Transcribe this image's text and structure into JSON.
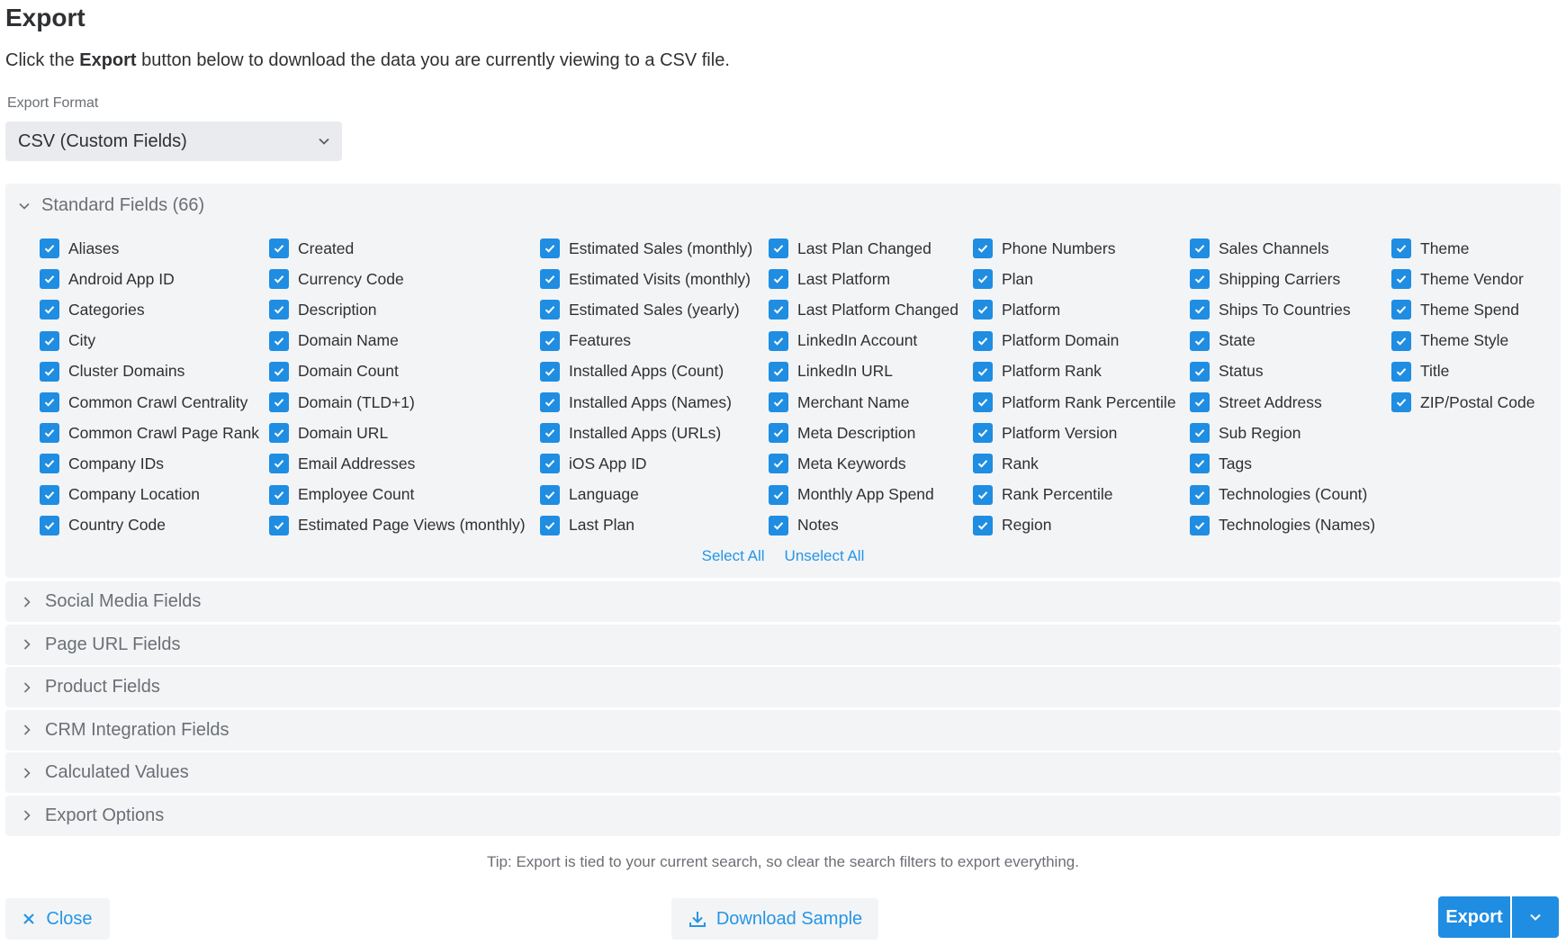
{
  "page": {
    "title": "Export",
    "intro_prefix": "Click the ",
    "intro_bold": "Export",
    "intro_suffix": " button below to download the data you are currently viewing to a CSV file."
  },
  "export_format": {
    "label": "Export Format",
    "selected": "CSV (Custom Fields)"
  },
  "standard_fields": {
    "title": "Standard Fields (66)",
    "columns": [
      [
        "Aliases",
        "Android App ID",
        "Categories",
        "City",
        "Cluster Domains",
        "Common Crawl Centrality",
        "Common Crawl Page Rank",
        "Company IDs",
        "Company Location",
        "Country Code"
      ],
      [
        "Created",
        "Currency Code",
        "Description",
        "Domain Name",
        "Domain Count",
        "Domain (TLD+1)",
        "Domain URL",
        "Email Addresses",
        "Employee Count",
        "Estimated Page Views (monthly)"
      ],
      [
        "Estimated Sales (monthly)",
        "Estimated Visits (monthly)",
        "Estimated Sales (yearly)",
        "Features",
        "Installed Apps (Count)",
        "Installed Apps (Names)",
        "Installed Apps (URLs)",
        "iOS App ID",
        "Language",
        "Last Plan"
      ],
      [
        "Last Plan Changed",
        "Last Platform",
        "Last Platform Changed",
        "LinkedIn Account",
        "LinkedIn URL",
        "Merchant Name",
        "Meta Description",
        "Meta Keywords",
        "Monthly App Spend",
        "Notes"
      ],
      [
        "Phone Numbers",
        "Plan",
        "Platform",
        "Platform Domain",
        "Platform Rank",
        "Platform Rank Percentile",
        "Platform Version",
        "Rank",
        "Rank Percentile",
        "Region"
      ],
      [
        "Sales Channels",
        "Shipping Carriers",
        "Ships To Countries",
        "State",
        "Status",
        "Street Address",
        "Sub Region",
        "Tags",
        "Technologies (Count)",
        "Technologies (Names)"
      ],
      [
        "Theme",
        "Theme Vendor",
        "Theme Spend",
        "Theme Style",
        "Title",
        "ZIP/Postal Code"
      ]
    ],
    "select_all": "Select All",
    "unselect_all": "Unselect All"
  },
  "sections": [
    "Social Media Fields",
    "Page URL Fields",
    "Product Fields",
    "CRM Integration Fields",
    "Calculated Values",
    "Export Options"
  ],
  "tip": "Tip: Export is tied to your current search, so clear the search filters to export everything.",
  "buttons": {
    "close": "Close",
    "download_sample": "Download Sample",
    "export": "Export"
  },
  "colors": {
    "accent": "#1f8de2",
    "link": "#2596e6",
    "panel_bg": "#f3f4f6"
  }
}
